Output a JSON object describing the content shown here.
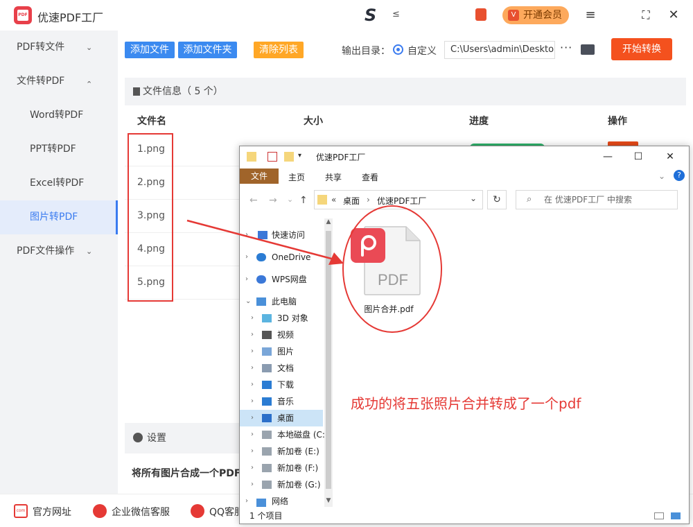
{
  "app": {
    "title": "优速PDF工厂",
    "vip_label": "开通会员"
  },
  "sidebar": {
    "items": [
      {
        "label": "PDF转文件",
        "chevron": "⌄"
      },
      {
        "label": "文件转PDF",
        "chevron": "⌃"
      },
      {
        "label": "Word转PDF"
      },
      {
        "label": "PPT转PDF"
      },
      {
        "label": "Excel转PDF"
      },
      {
        "label": "图片转PDF"
      },
      {
        "label": "PDF文件操作",
        "chevron": "⌄"
      }
    ]
  },
  "toolbar": {
    "add_file": "添加文件",
    "add_folder": "添加文件夹",
    "clear_list": "清除列表",
    "output_label": "输出目录：",
    "radio_label": "自定义",
    "output_path": "C:\\Users\\admin\\Desktop",
    "more": "···",
    "start": "开始转换"
  },
  "file_panel": {
    "info": "文件信息（ 5 个）",
    "columns": [
      "文件名",
      "大小",
      "进度",
      "操作"
    ],
    "files": [
      "1.png",
      "2.png",
      "3.png",
      "4.png",
      "5.png"
    ],
    "settings_label": "设置",
    "merge_text": "将所有图片合成一个PDF"
  },
  "footer": {
    "links": [
      "官方网址",
      "企业微信客服",
      "QQ客服"
    ],
    "web_icon_text": "com"
  },
  "explorer": {
    "title": "优速PDF工厂",
    "tabs": [
      "文件",
      "主页",
      "共享",
      "查看"
    ],
    "breadcrumb": [
      "«",
      "桌面",
      "›",
      "优速PDF工厂"
    ],
    "search_placeholder": "在 优速PDF工厂 中搜索",
    "nav": [
      {
        "label": "快速访问"
      },
      {
        "label": "OneDrive"
      },
      {
        "label": "WPS网盘"
      },
      {
        "label": "此电脑"
      },
      {
        "label": "3D 对象"
      },
      {
        "label": "视频"
      },
      {
        "label": "图片"
      },
      {
        "label": "文档"
      },
      {
        "label": "下载"
      },
      {
        "label": "音乐"
      },
      {
        "label": "桌面"
      },
      {
        "label": "本地磁盘 (C:)"
      },
      {
        "label": "新加卷 (E:)"
      },
      {
        "label": "新加卷 (F:)"
      },
      {
        "label": "新加卷 (G:)"
      },
      {
        "label": "网络"
      }
    ],
    "file_name": "图片合并.pdf",
    "pdf_text": "PDF",
    "status": "1 个项目"
  },
  "annotation": {
    "note": "成功的将五张照片合并转成了一个pdf"
  },
  "colors": {
    "accent_blue": "#3b8af0",
    "start_red": "#f4511e",
    "annotation_red": "#e53935",
    "clear_orange": "#ffa726"
  }
}
